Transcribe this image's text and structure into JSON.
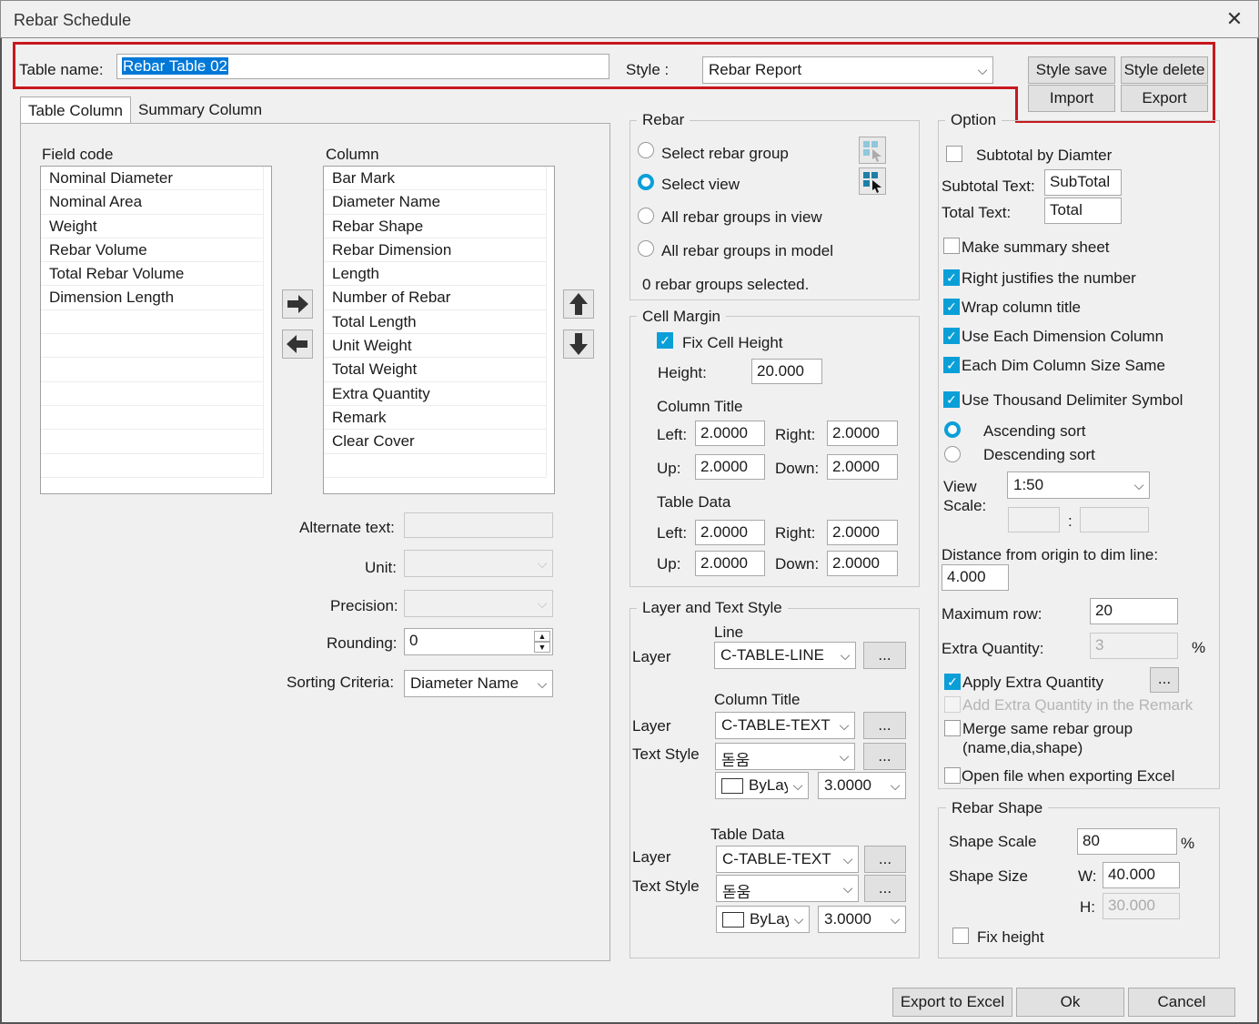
{
  "window": {
    "title": "Rebar Schedule",
    "close_glyph": "✕"
  },
  "header": {
    "table_name_label": "Table name:",
    "table_name_value": "Rebar Table 02",
    "style_label": "Style :",
    "style_value": "Rebar Report",
    "style_save": "Style save",
    "style_delete": "Style delete",
    "import": "Import",
    "export": "Export"
  },
  "tabs": [
    {
      "label": "Table Column"
    },
    {
      "label": "Summary Column"
    }
  ],
  "table_column": {
    "field_code_label": "Field code",
    "column_label": "Column",
    "field_codes": [
      "Nominal Diameter",
      "Nominal Area",
      "Weight",
      "Rebar Volume",
      "Total Rebar Volume",
      "Dimension Length"
    ],
    "columns": [
      "Bar Mark",
      "Diameter Name",
      "Rebar Shape",
      "Rebar Dimension",
      "Length",
      "Number of Rebar",
      "Total Length",
      "Unit Weight",
      "Total Weight",
      "Extra Quantity",
      "Remark",
      "Clear Cover"
    ],
    "alternate_text_label": "Alternate text:",
    "unit_label": "Unit:",
    "precision_label": "Precision:",
    "rounding_label": "Rounding:",
    "rounding_value": "0",
    "sorting_label": "Sorting Criteria:",
    "sorting_value": "Diameter Name"
  },
  "rebar": {
    "title": "Rebar",
    "select_rebar_group": "Select rebar group",
    "select_view": "Select view",
    "all_in_view": "All rebar groups in view",
    "all_in_model": "All rebar groups in model",
    "status": "0 rebar groups selected."
  },
  "cell_margin": {
    "title": "Cell Margin",
    "fix_cell_height": "Fix Cell Height",
    "height_label": "Height:",
    "height_value": "20.000",
    "column_title_label": "Column Title",
    "table_data_label": "Table Data",
    "left_label": "Left:",
    "right_label": "Right:",
    "up_label": "Up:",
    "down_label": "Down:",
    "ct_left": "2.0000",
    "ct_right": "2.0000",
    "ct_up": "2.0000",
    "ct_down": "2.0000",
    "td_left": "2.0000",
    "td_right": "2.0000",
    "td_up": "2.0000",
    "td_down": "2.0000"
  },
  "layer_text_style": {
    "title": "Layer and Text Style",
    "line_label": "Line",
    "column_title_label": "Column Title",
    "table_data_label": "Table Data",
    "layer_label": "Layer",
    "text_style_label": "Text Style",
    "line_layer": "C-TABLE-LINE",
    "ct_layer": "C-TABLE-TEXT",
    "ct_text_style": "돋움",
    "ct_color": "ByLayer",
    "ct_size": "3.0000",
    "td_layer": "C-TABLE-TEXT",
    "td_text_style": "돋움",
    "td_color": "ByLayer",
    "td_size": "3.0000",
    "more": "..."
  },
  "option": {
    "title": "Option",
    "subtotal_by_diameter": "Subtotal by Diamter",
    "subtotal_text_label": "Subtotal Text:",
    "subtotal_text_value": "SubTotal",
    "total_text_label": "Total Text:",
    "total_text_value": "Total",
    "make_summary": "Make summary sheet",
    "right_justifies": "Right justifies the number",
    "wrap_title": "Wrap column title",
    "use_each_dim": "Use Each Dimension Column",
    "each_dim_same": "Each Dim Column Size Same",
    "use_thousand": "Use Thousand Delimiter Symbol",
    "ascending": "Ascending sort",
    "descending": "Descending sort",
    "view_label": "View",
    "scale_label": "Scale:",
    "view_scale_value": "1:50",
    "colon": ":",
    "distance_label": "Distance from origin to dim line:",
    "distance_value": "4.000",
    "max_row_label": "Maximum row:",
    "max_row_value": "20",
    "extra_qty_label": "Extra Quantity:",
    "extra_qty_value": "3",
    "percent": "%",
    "apply_extra": "Apply Extra Quantity",
    "add_extra_remark": "Add Extra Quantity in the Remark",
    "merge_same": "Merge same rebar group",
    "merge_same_2": "(name,dia,shape)",
    "open_file": "Open file when exporting Excel"
  },
  "rebar_shape": {
    "title": "Rebar Shape",
    "shape_scale_label": "Shape Scale",
    "shape_scale_value": "80",
    "percent": "%",
    "shape_size_label": "Shape Size",
    "w_label": "W:",
    "w_value": "40.000",
    "h_label": "H:",
    "h_value": "30.000",
    "fix_height": "Fix height"
  },
  "footer": {
    "export_excel": "Export to Excel",
    "ok": "Ok",
    "cancel": "Cancel"
  },
  "colors": {
    "accent": "#0b9fd8",
    "highlight": "#c8181e",
    "selection": "#0078d7"
  }
}
